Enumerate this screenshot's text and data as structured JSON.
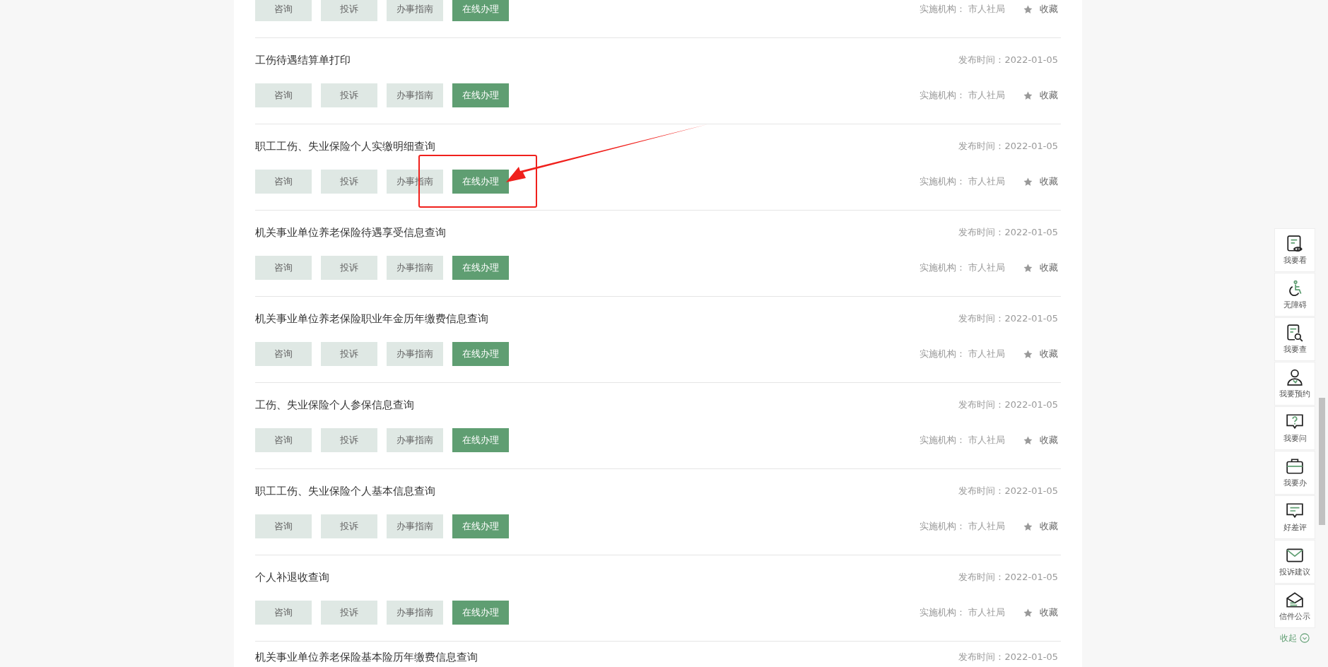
{
  "services": [
    {
      "buttons": [
        {
          "label": "咨询",
          "kind": "plain"
        },
        {
          "label": "投诉",
          "kind": "plain"
        },
        {
          "label": "办事指南",
          "kind": "plain"
        },
        {
          "label": "在线办理",
          "kind": "primary"
        }
      ],
      "agency": "实施机构： 市人社局",
      "favorite": "收藏"
    },
    {
      "title": "工伤待遇结算单打印",
      "published": "发布时间：2022-01-05",
      "buttons": [
        {
          "label": "咨询",
          "kind": "plain"
        },
        {
          "label": "投诉",
          "kind": "plain"
        },
        {
          "label": "办事指南",
          "kind": "plain"
        },
        {
          "label": "在线办理",
          "kind": "primary"
        }
      ],
      "agency": "实施机构： 市人社局",
      "favorite": "收藏"
    },
    {
      "title": "职工工伤、失业保险个人实缴明细查询",
      "published": "发布时间：2022-01-05",
      "buttons": [
        {
          "label": "咨询",
          "kind": "plain"
        },
        {
          "label": "投诉",
          "kind": "plain"
        },
        {
          "label": "办事指南",
          "kind": "plain"
        },
        {
          "label": "在线办理",
          "kind": "primary"
        }
      ],
      "agency": "实施机构： 市人社局",
      "favorite": "收藏"
    },
    {
      "title": "机关事业单位养老保险待遇享受信息查询",
      "published": "发布时间：2022-01-05",
      "buttons": [
        {
          "label": "咨询",
          "kind": "plain"
        },
        {
          "label": "投诉",
          "kind": "plain"
        },
        {
          "label": "办事指南",
          "kind": "plain"
        },
        {
          "label": "在线办理",
          "kind": "primary"
        }
      ],
      "agency": "实施机构： 市人社局",
      "favorite": "收藏"
    },
    {
      "title": "机关事业单位养老保险职业年金历年缴费信息查询",
      "published": "发布时间：2022-01-05",
      "buttons": [
        {
          "label": "咨询",
          "kind": "plain"
        },
        {
          "label": "投诉",
          "kind": "plain"
        },
        {
          "label": "办事指南",
          "kind": "plain"
        },
        {
          "label": "在线办理",
          "kind": "primary"
        }
      ],
      "agency": "实施机构： 市人社局",
      "favorite": "收藏"
    },
    {
      "title": "工伤、失业保险个人参保信息查询",
      "published": "发布时间：2022-01-05",
      "buttons": [
        {
          "label": "咨询",
          "kind": "plain"
        },
        {
          "label": "投诉",
          "kind": "plain"
        },
        {
          "label": "办事指南",
          "kind": "plain"
        },
        {
          "label": "在线办理",
          "kind": "primary"
        }
      ],
      "agency": "实施机构： 市人社局",
      "favorite": "收藏"
    },
    {
      "title": "职工工伤、失业保险个人基本信息查询",
      "published": "发布时间：2022-01-05",
      "buttons": [
        {
          "label": "咨询",
          "kind": "plain"
        },
        {
          "label": "投诉",
          "kind": "plain"
        },
        {
          "label": "办事指南",
          "kind": "plain"
        },
        {
          "label": "在线办理",
          "kind": "primary"
        }
      ],
      "agency": "实施机构： 市人社局",
      "favorite": "收藏"
    },
    {
      "title": "个人补退收查询",
      "published": "发布时间：2022-01-05",
      "buttons": [
        {
          "label": "咨询",
          "kind": "plain"
        },
        {
          "label": "投诉",
          "kind": "plain"
        },
        {
          "label": "办事指南",
          "kind": "plain"
        },
        {
          "label": "在线办理",
          "kind": "primary"
        }
      ],
      "agency": "实施机构： 市人社局",
      "favorite": "收藏"
    },
    {
      "title": "机关事业单位养老保险基本险历年缴费信息查询",
      "published": "发布时间：2022-01-05"
    }
  ],
  "sidebar": {
    "items": [
      {
        "label": "我要看"
      },
      {
        "label": "无障碍"
      },
      {
        "label": "我要查"
      },
      {
        "label": "我要预约"
      },
      {
        "label": "我要问"
      },
      {
        "label": "我要办"
      },
      {
        "label": "好差评"
      },
      {
        "label": "投诉建议"
      },
      {
        "label": "信件公示"
      }
    ],
    "collapse": "收起"
  }
}
